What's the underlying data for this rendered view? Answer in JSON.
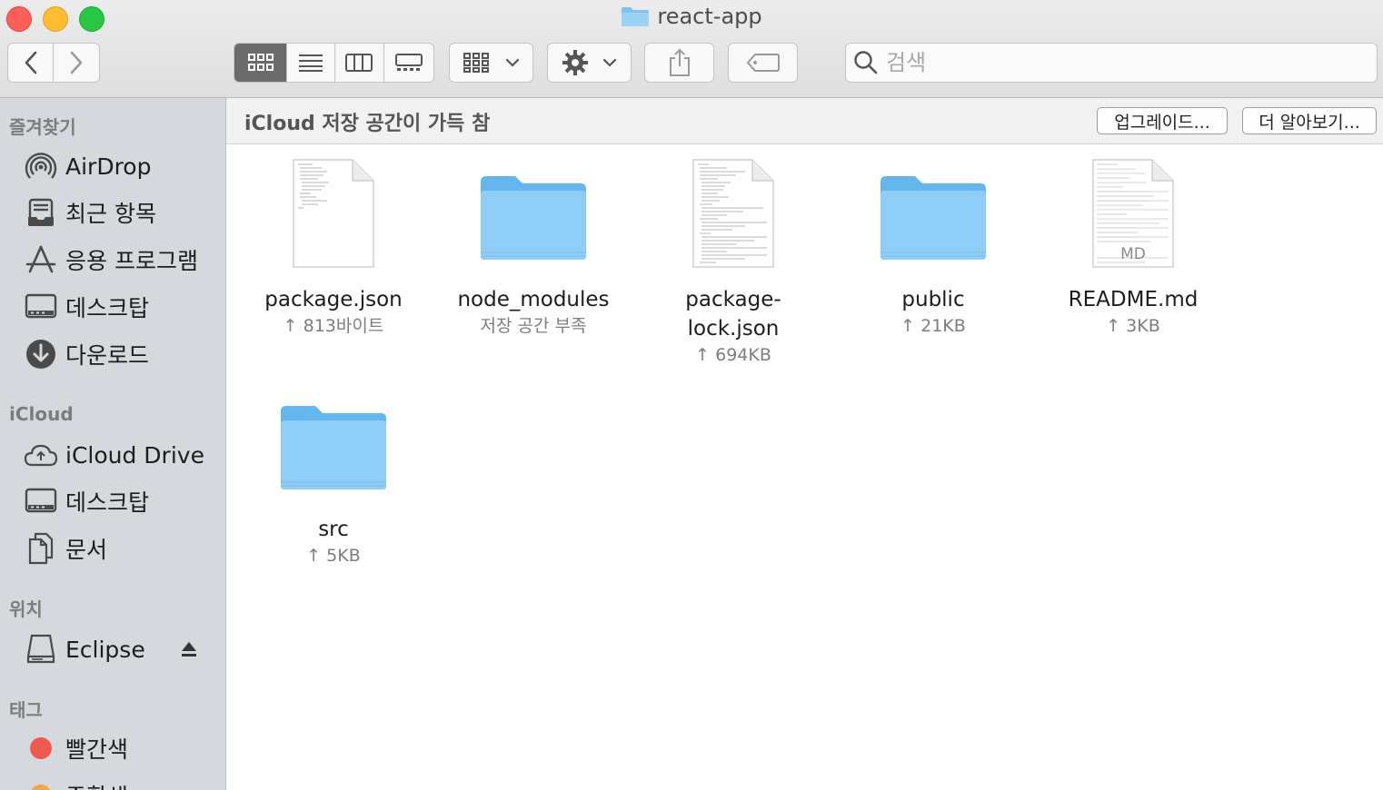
{
  "window": {
    "title": "react-app"
  },
  "search": {
    "placeholder": "검색"
  },
  "sidebar": {
    "favorites_header": "즐겨찾기",
    "favorites": [
      {
        "label": "AirDrop",
        "icon": "airdrop-icon"
      },
      {
        "label": "최근 항목",
        "icon": "recents-icon"
      },
      {
        "label": "응용 프로그램",
        "icon": "applications-icon"
      },
      {
        "label": "데스크탑",
        "icon": "desktop-icon"
      },
      {
        "label": "다운로드",
        "icon": "downloads-icon"
      }
    ],
    "icloud_header": "iCloud",
    "icloud": [
      {
        "label": "iCloud Drive",
        "icon": "icloud-icon"
      },
      {
        "label": "데스크탑",
        "icon": "desktop-icon"
      },
      {
        "label": "문서",
        "icon": "documents-icon"
      }
    ],
    "locations_header": "위치",
    "locations": [
      {
        "label": "Eclipse",
        "icon": "disk-icon"
      }
    ],
    "tags_header": "태그",
    "tags": [
      {
        "label": "빨간색",
        "color": "#ee5a52"
      },
      {
        "label": "주황색",
        "color": "#f5a53a"
      }
    ]
  },
  "banner": {
    "text": "iCloud 저장 공간이 가득 참",
    "upgrade": "업그레이드...",
    "learn_more": "더 알아보기..."
  },
  "files": [
    {
      "name": "package.json",
      "meta": "↑ 813바이트",
      "kind": "document"
    },
    {
      "name": "node_modules",
      "meta": "저장 공간 부족",
      "kind": "folder"
    },
    {
      "name": "package-\nlock.json",
      "meta": "↑ 694KB",
      "kind": "document"
    },
    {
      "name": "public",
      "meta": "↑ 21KB",
      "kind": "folder"
    },
    {
      "name": "README.md",
      "meta": "↑ 3KB",
      "kind": "document",
      "badge": "MD"
    },
    {
      "name": "src",
      "meta": "↑ 5KB",
      "kind": "folder"
    }
  ]
}
